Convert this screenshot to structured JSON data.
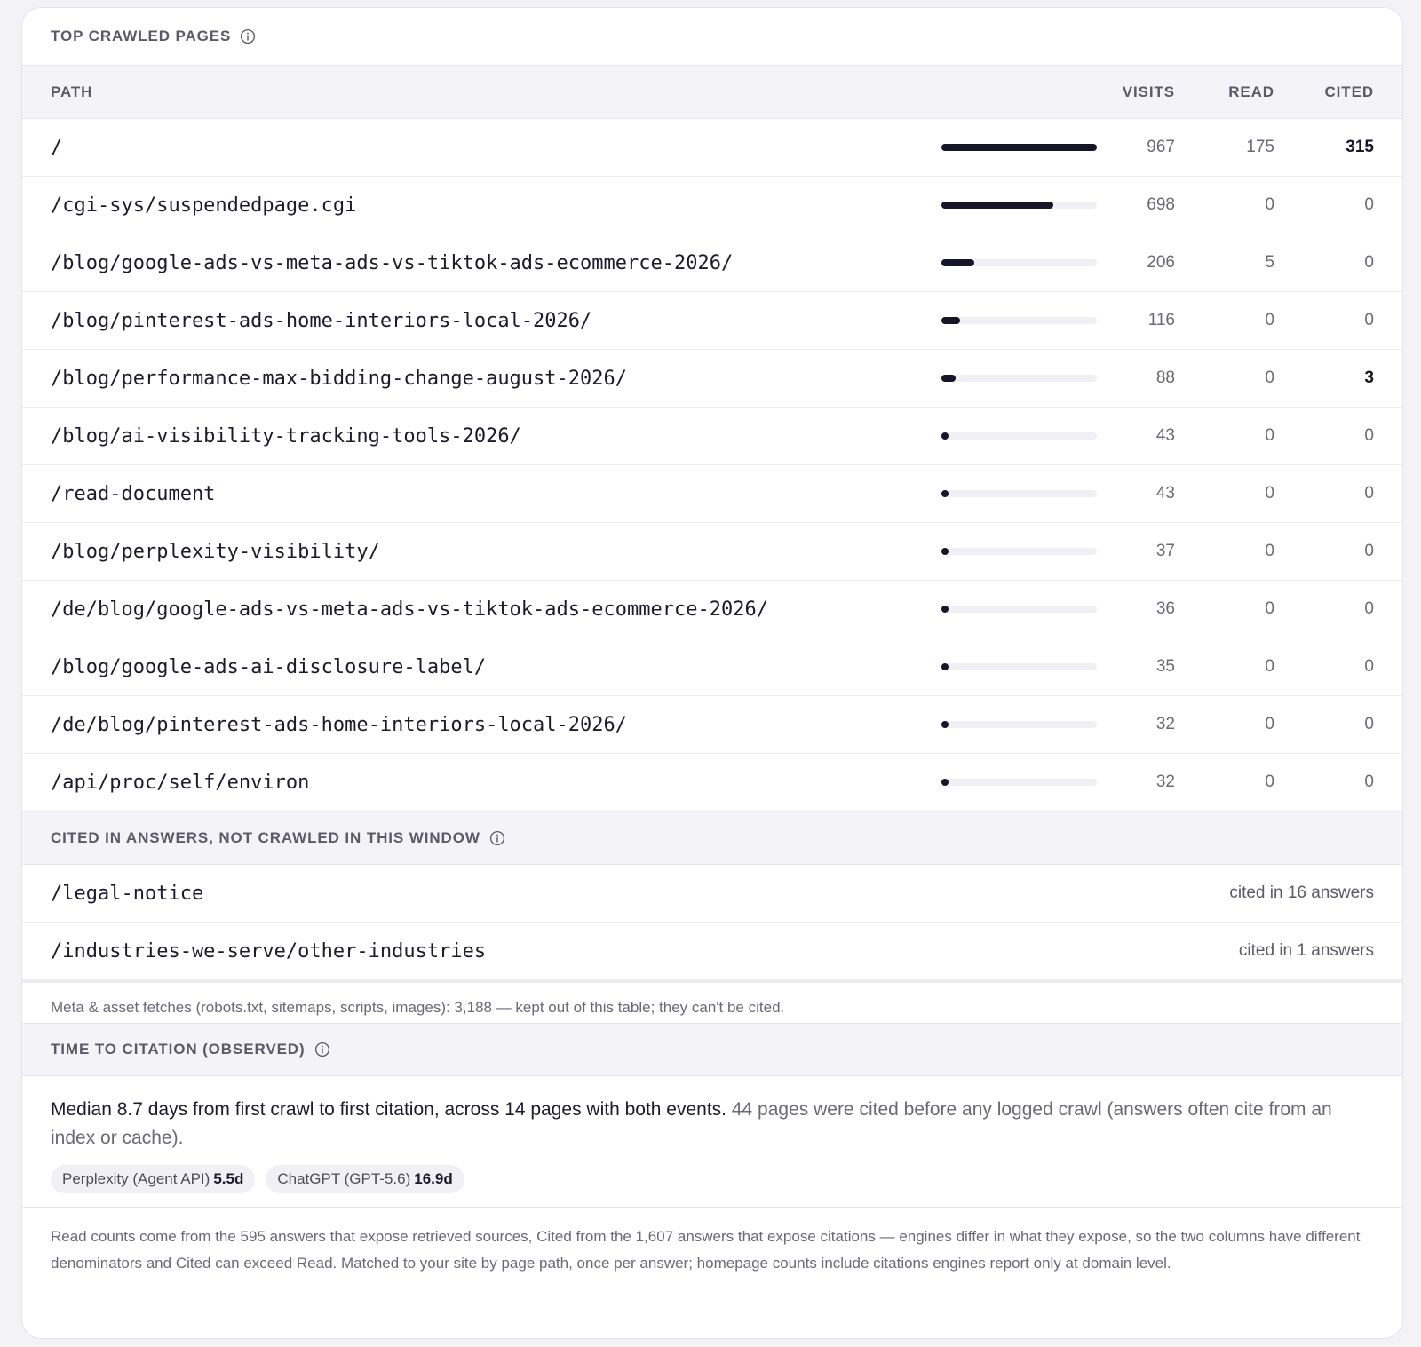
{
  "top_crawled": {
    "title": "TOP CRAWLED PAGES",
    "columns": {
      "path": "PATH",
      "visits": "VISITS",
      "read": "READ",
      "cited": "CITED"
    },
    "max_visits": 967,
    "rows": [
      {
        "path": "/",
        "visits": "967",
        "visits_value": 967,
        "read": "175",
        "cited": "315",
        "cited_highlight": true
      },
      {
        "path": "/cgi-sys/suspendedpage.cgi",
        "visits": "698",
        "visits_value": 698,
        "read": "0",
        "cited": "0",
        "cited_highlight": false
      },
      {
        "path": "/blog/google-ads-vs-meta-ads-vs-tiktok-ads-ecommerce-2026/",
        "visits": "206",
        "visits_value": 206,
        "read": "5",
        "cited": "0",
        "cited_highlight": false
      },
      {
        "path": "/blog/pinterest-ads-home-interiors-local-2026/",
        "visits": "116",
        "visits_value": 116,
        "read": "0",
        "cited": "0",
        "cited_highlight": false
      },
      {
        "path": "/blog/performance-max-bidding-change-august-2026/",
        "visits": "88",
        "visits_value": 88,
        "read": "0",
        "cited": "3",
        "cited_highlight": true
      },
      {
        "path": "/blog/ai-visibility-tracking-tools-2026/",
        "visits": "43",
        "visits_value": 43,
        "read": "0",
        "cited": "0",
        "cited_highlight": false
      },
      {
        "path": "/read-document",
        "visits": "43",
        "visits_value": 43,
        "read": "0",
        "cited": "0",
        "cited_highlight": false
      },
      {
        "path": "/blog/perplexity-visibility/",
        "visits": "37",
        "visits_value": 37,
        "read": "0",
        "cited": "0",
        "cited_highlight": false
      },
      {
        "path": "/de/blog/google-ads-vs-meta-ads-vs-tiktok-ads-ecommerce-2026/",
        "visits": "36",
        "visits_value": 36,
        "read": "0",
        "cited": "0",
        "cited_highlight": false
      },
      {
        "path": "/blog/google-ads-ai-disclosure-label/",
        "visits": "35",
        "visits_value": 35,
        "read": "0",
        "cited": "0",
        "cited_highlight": false
      },
      {
        "path": "/de/blog/pinterest-ads-home-interiors-local-2026/",
        "visits": "32",
        "visits_value": 32,
        "read": "0",
        "cited": "0",
        "cited_highlight": false
      },
      {
        "path": "/api/proc/self/environ",
        "visits": "32",
        "visits_value": 32,
        "read": "0",
        "cited": "0",
        "cited_highlight": false
      }
    ]
  },
  "cited_not_crawled": {
    "title": "CITED IN ANSWERS, NOT CRAWLED IN THIS WINDOW",
    "rows": [
      {
        "path": "/legal-notice",
        "note": "cited in 16 answers"
      },
      {
        "path": "/industries-we-serve/other-industries",
        "note": "cited in 1 answers"
      }
    ]
  },
  "meta_note": "Meta & asset fetches (robots.txt, sitemaps, scripts, images): 3,188 — kept out of this table; they can't be cited.",
  "time_to_citation": {
    "title": "TIME TO CITATION (OBSERVED)",
    "summary": "Median 8.7 days from first crawl to first citation, across 14 pages with both events.",
    "summary_muted": " 44 pages were cited before any logged crawl (answers often cite from an index or cache).",
    "chips": [
      {
        "label": "Perplexity (Agent API)",
        "value": "5.5d"
      },
      {
        "label": "ChatGPT (GPT-5.6)",
        "value": "16.9d"
      }
    ]
  },
  "footer_note": "Read counts come from the 595 answers that expose retrieved sources, Cited from the 1,607 answers that expose citations — engines differ in what they expose, so the two columns have different denominators and Cited can exceed Read. Matched to your site by page path, once per answer; homepage counts include citations engines report only at domain level.",
  "icons": {
    "info": "info-circle-icon"
  },
  "colors": {
    "bar": "#171629",
    "track": "#f0f0f4",
    "header_bg": "#f4f4f8"
  }
}
